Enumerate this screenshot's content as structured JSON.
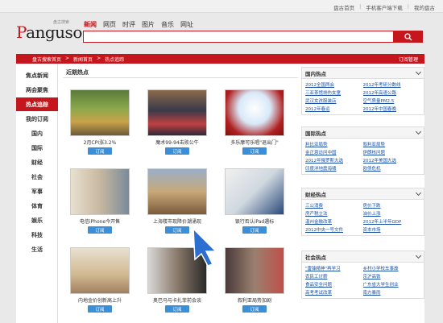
{
  "topbar": {
    "links": [
      "盘古首页",
      "手机客户端下载",
      "我的盘古"
    ]
  },
  "logo": {
    "text": "Panguso",
    "sub": "盘古搜索"
  },
  "nav": {
    "tabs": [
      "新闻",
      "网页",
      "时评",
      "图片",
      "音乐",
      "网址"
    ],
    "active": 0
  },
  "search": {
    "placeholder": ""
  },
  "breadcrumb": {
    "items": [
      "盘古搜索首页",
      "新闻首页",
      "热点追踪"
    ],
    "manage": "订阅管理"
  },
  "sidebar": {
    "items": [
      "焦点新闻",
      "两会聚焦",
      "热点追踪",
      "我的订阅",
      "国内",
      "国际",
      "财经",
      "社会",
      "军事",
      "体育",
      "娱乐",
      "科技",
      "生活"
    ],
    "active": 2
  },
  "main": {
    "title": "近期热点",
    "cards": [
      {
        "caption": "2月CPI涨3.2%",
        "button": "订阅"
      },
      {
        "caption": "魔术99-94击败公牛",
        "button": "订阅"
      },
      {
        "caption": "多乐摩可乐唱\"退出门\"",
        "button": "订阅"
      },
      {
        "caption": "电信iPhone今开售",
        "button": "订阅"
      },
      {
        "caption": "上海楼市现降价潮涌现",
        "button": "订阅"
      },
      {
        "caption": "银行否认iPad遇标",
        "button": "订阅"
      },
      {
        "caption": "内地金价创新高上升",
        "button": "订阅"
      },
      {
        "caption": "奥巴马与卡扎菲前会谈",
        "button": "订阅"
      },
      {
        "caption": "叙利亚局势加剧",
        "button": "订阅"
      }
    ]
  },
  "right": {
    "boxes": [
      {
        "title": "国内热点",
        "links": [
          "2012全国两会",
          "2012年考研分数线",
          "三亚茶馆烧伤女童",
          "2012年高速公路",
          "武汉女孩服装店",
          "空气质量PM2.5",
          "2012年春运",
          "2012年中国春晚"
        ]
      },
      {
        "title": "国际热点",
        "links": [
          "利比亚局势",
          "叙利亚局势",
          "金正恩访问中国",
          "伊朗核问题",
          "2012年俄罗斯大选",
          "2012年美国大选",
          "印度洋地震海啸",
          "欧债危机"
        ]
      },
      {
        "title": "财经热点",
        "links": [
          "三公消费",
          "房价下跌",
          "房产税立法",
          "油价上涨",
          "温州金融改革",
          "2012年上半年GDP",
          "2012中央一号文件",
          "资本市场"
        ]
      },
      {
        "title": "社会热点",
        "links": [
          "\"雷锋精神\"再学习",
          "乡村小学校车事故",
          "农民工讨薪",
          "京沪高铁",
          "食品安全问题",
          "广东省大学生创业",
          "高考考试改革",
          "南方暴雨"
        ]
      }
    ]
  }
}
